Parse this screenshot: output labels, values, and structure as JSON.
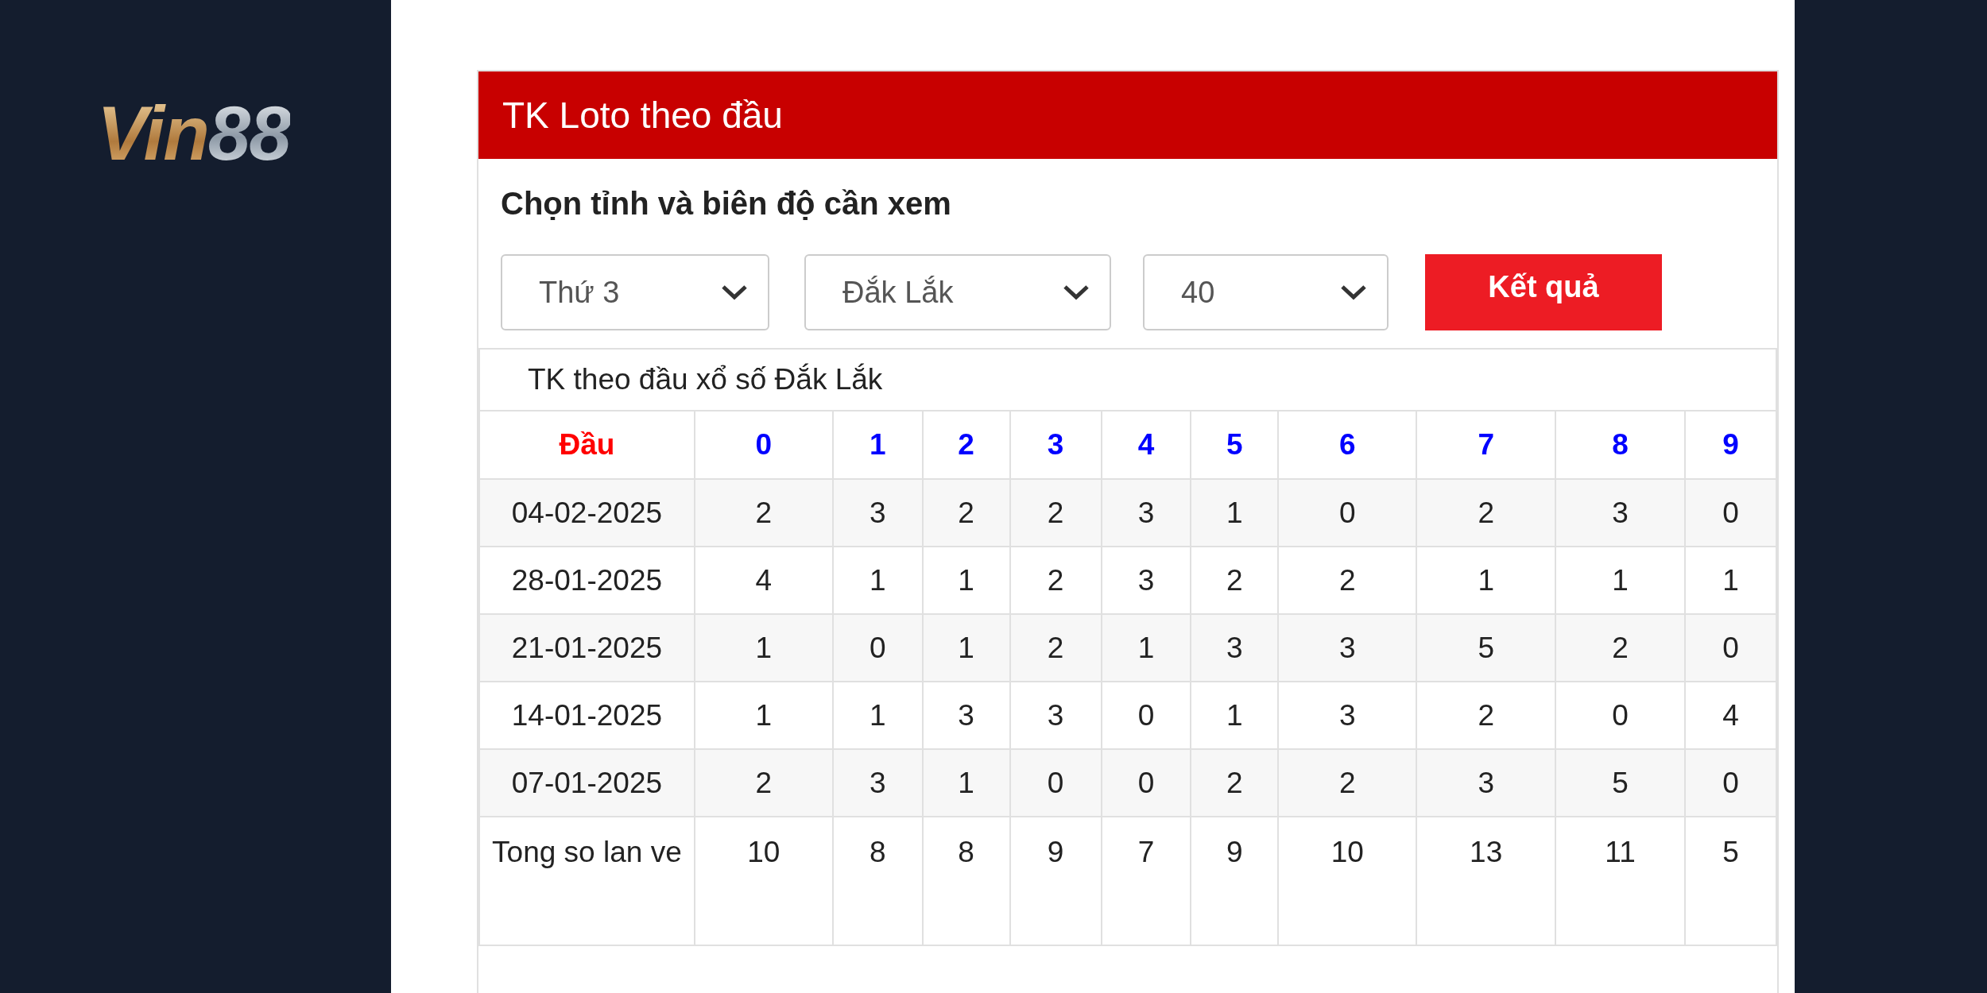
{
  "logo": {
    "text_gold": "Vin",
    "text_silver": "88"
  },
  "card": {
    "title": "TK Loto theo đầu",
    "subtitle": "Chọn tỉnh và biên độ cần xem",
    "selects": [
      {
        "value": "Thứ 3"
      },
      {
        "value": "Đắk Lắk"
      },
      {
        "value": "40"
      }
    ],
    "submit_button": "Kết quả"
  },
  "table": {
    "caption": "TK theo đầu xổ số Đắk Lắk",
    "columns": [
      "Đầu",
      "0",
      "1",
      "2",
      "3",
      "4",
      "5",
      "6",
      "7",
      "8",
      "9"
    ],
    "rows": [
      [
        "04-02-2025",
        "2",
        "3",
        "2",
        "2",
        "3",
        "1",
        "0",
        "2",
        "3",
        "0"
      ],
      [
        "28-01-2025",
        "4",
        "1",
        "1",
        "2",
        "3",
        "2",
        "2",
        "1",
        "1",
        "1"
      ],
      [
        "21-01-2025",
        "1",
        "0",
        "1",
        "2",
        "1",
        "3",
        "3",
        "5",
        "2",
        "0"
      ],
      [
        "14-01-2025",
        "1",
        "1",
        "3",
        "3",
        "0",
        "1",
        "3",
        "2",
        "0",
        "4"
      ],
      [
        "07-01-2025",
        "2",
        "3",
        "1",
        "0",
        "0",
        "2",
        "2",
        "3",
        "5",
        "0"
      ],
      [
        "Tong so lan ve",
        "10",
        "8",
        "8",
        "9",
        "7",
        "9",
        "10",
        "13",
        "11",
        "5"
      ]
    ]
  }
}
